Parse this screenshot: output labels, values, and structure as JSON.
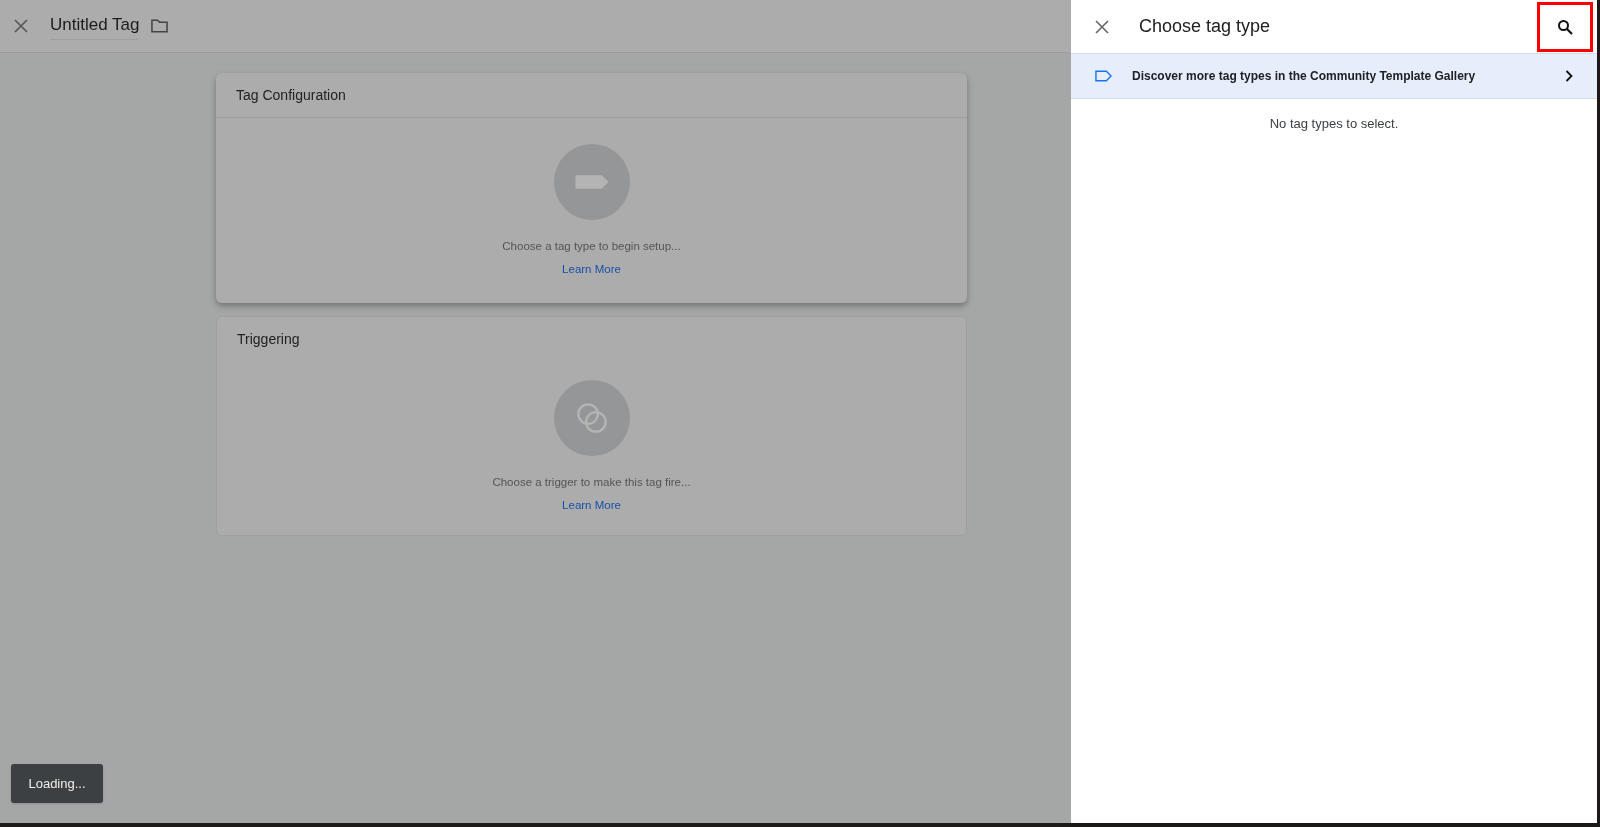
{
  "header": {
    "title": "Untitled Tag"
  },
  "cards": [
    {
      "kind": "tag",
      "title": "Tag Configuration",
      "message": "Choose a tag type to begin setup...",
      "link": "Learn More",
      "divider": true
    },
    {
      "kind": "trigger",
      "title": "Triggering",
      "message": "Choose a trigger to make this tag fire...",
      "link": "Learn More",
      "divider": false
    }
  ],
  "toast": {
    "text": "Loading..."
  },
  "panel": {
    "title": "Choose tag type",
    "search_highlighted": true,
    "gallery_row": {
      "text": "Discover more tag types in the Community Template Gallery"
    },
    "empty_message": "No tag types to select."
  }
}
